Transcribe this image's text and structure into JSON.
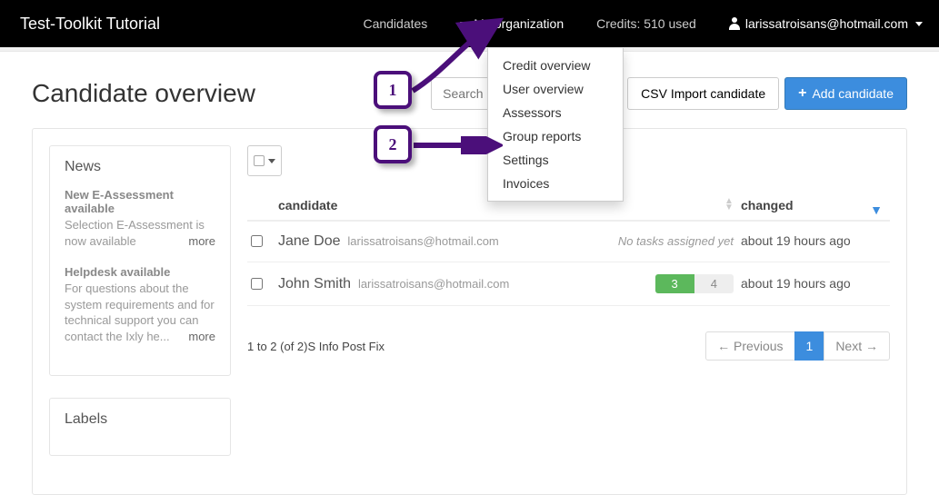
{
  "brand": "Test-Toolkit Tutorial",
  "nav": {
    "candidates": "Candidates",
    "my_org": "My organization",
    "credits": "Credits: 510 used",
    "user": "larissatroisans@hotmail.com"
  },
  "dropdown": {
    "credit_overview": "Credit overview",
    "user_overview": "User overview",
    "assessors": "Assessors",
    "group_reports": "Group reports",
    "settings": "Settings",
    "invoices": "Invoices"
  },
  "page": {
    "title": "Candidate overview",
    "search_placeholder": "Search",
    "csv_import": "CSV Import candidate",
    "add_candidate": "Add candidate"
  },
  "news": {
    "heading": "News",
    "items": [
      {
        "head": "New E-Assessment available",
        "body": "Selection E-Assessment is now available",
        "more": "more"
      },
      {
        "head": "Helpdesk available",
        "body": "For questions about the system requirements and for technical support you can contact the Ixly he...",
        "more": "more"
      }
    ]
  },
  "labels": {
    "heading": "Labels"
  },
  "table": {
    "col_candidate": "candidate",
    "col_changed": "changed",
    "rows": [
      {
        "name": "Jane Doe",
        "email": "larissatroisans@hotmail.com",
        "tasks_text": "No tasks assigned yet",
        "badges": null,
        "changed": "about 19 hours ago"
      },
      {
        "name": "John Smith",
        "email": "larissatroisans@hotmail.com",
        "tasks_text": null,
        "badges": {
          "green": "3",
          "gray": "4"
        },
        "changed": "about 19 hours ago"
      }
    ],
    "page_info_prefix": "1 to 2 (of 2)",
    "page_info_suffix": "S Info Post Fix",
    "prev": "← Previous",
    "page1": "1",
    "next": "Next →"
  },
  "annotations": {
    "one": "1",
    "two": "2"
  }
}
